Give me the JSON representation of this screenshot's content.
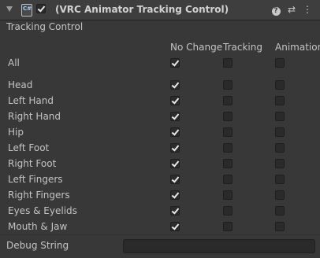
{
  "header": {
    "title": "(VRC Animator Tracking Control)",
    "enabled": true,
    "icons": [
      "foldout-arrow-icon",
      "script-icon",
      "help-icon",
      "presets-icon",
      "menu-icon"
    ]
  },
  "section_label": "Tracking Control",
  "columns": [
    "No Change",
    "Tracking",
    "Animation"
  ],
  "rows": [
    {
      "label": "All",
      "no_change": true,
      "tracking": false,
      "animation": false
    },
    {
      "label": "Head",
      "no_change": true,
      "tracking": false,
      "animation": false
    },
    {
      "label": "Left Hand",
      "no_change": true,
      "tracking": false,
      "animation": false
    },
    {
      "label": "Right Hand",
      "no_change": true,
      "tracking": false,
      "animation": false
    },
    {
      "label": "Hip",
      "no_change": true,
      "tracking": false,
      "animation": false
    },
    {
      "label": "Left Foot",
      "no_change": true,
      "tracking": false,
      "animation": false
    },
    {
      "label": "Right Foot",
      "no_change": true,
      "tracking": false,
      "animation": false
    },
    {
      "label": "Left Fingers",
      "no_change": true,
      "tracking": false,
      "animation": false
    },
    {
      "label": "Right Fingers",
      "no_change": true,
      "tracking": false,
      "animation": false
    },
    {
      "label": "Eyes & Eyelids",
      "no_change": true,
      "tracking": false,
      "animation": false
    },
    {
      "label": "Mouth & Jaw",
      "no_change": true,
      "tracking": false,
      "animation": false
    }
  ],
  "debug": {
    "label": "Debug String",
    "value": ""
  }
}
